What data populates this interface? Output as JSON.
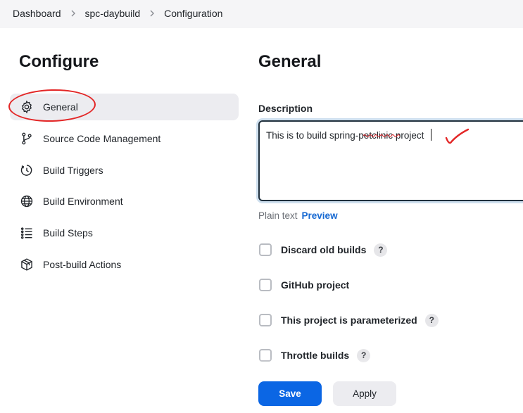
{
  "breadcrumb": {
    "items": [
      "Dashboard",
      "spc-daybuild",
      "Configuration"
    ]
  },
  "sidebar": {
    "title": "Configure",
    "items": [
      {
        "label": "General",
        "icon": "gear-icon",
        "active": true
      },
      {
        "label": "Source Code Management",
        "icon": "branch-icon"
      },
      {
        "label": "Build Triggers",
        "icon": "clock-icon"
      },
      {
        "label": "Build Environment",
        "icon": "globe-icon"
      },
      {
        "label": "Build Steps",
        "icon": "list-icon"
      },
      {
        "label": "Post-build Actions",
        "icon": "package-icon"
      }
    ]
  },
  "main": {
    "title": "General",
    "description": {
      "label": "Description",
      "value": "This is to build spring-petclinic project",
      "format_plain": "Plain text",
      "format_preview": "Preview"
    },
    "options": [
      {
        "label": "Discard old builds",
        "checked": false,
        "help": "?"
      },
      {
        "label": "GitHub project",
        "checked": false
      },
      {
        "label": "This project is parameterized",
        "checked": false,
        "help": "?"
      },
      {
        "label": "Throttle builds",
        "checked": false,
        "help": "?"
      }
    ]
  },
  "footer": {
    "save_label": "Save",
    "apply_label": "Apply"
  },
  "colors": {
    "primary": "#0b66e4",
    "annotation": "#e32626",
    "link": "#1769d2"
  }
}
